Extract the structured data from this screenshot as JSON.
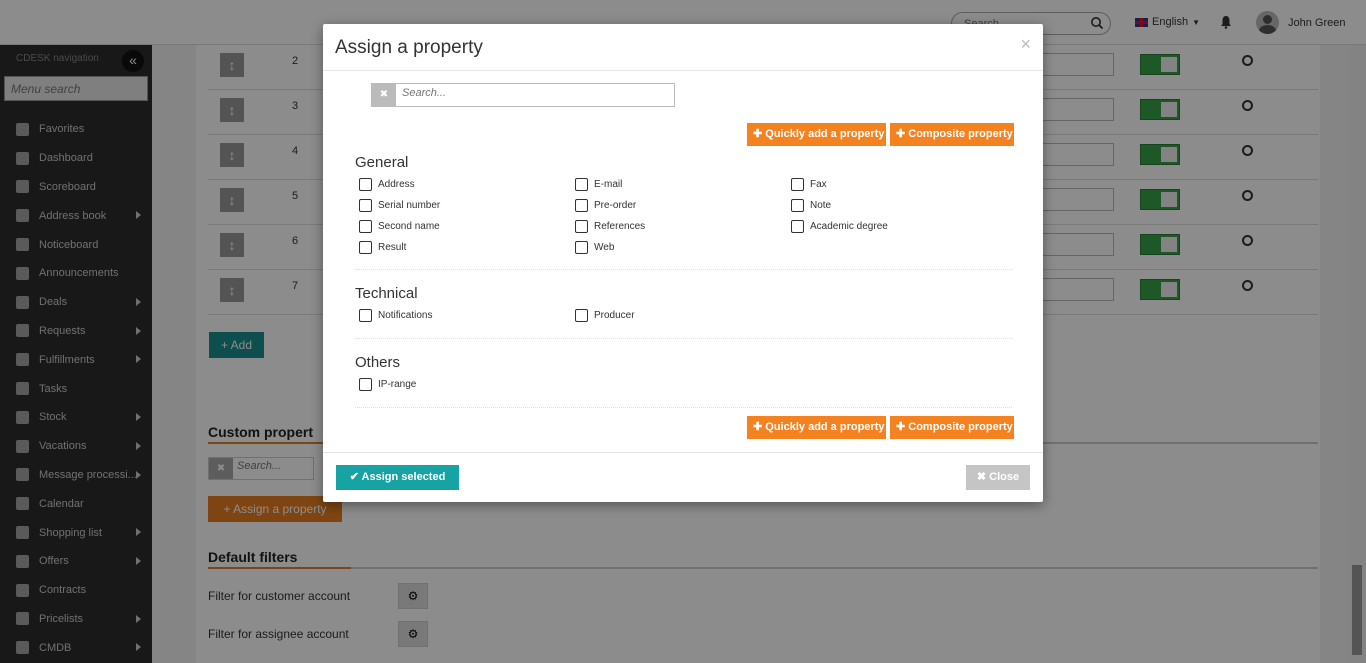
{
  "topbar": {
    "search_placeholder": "Search",
    "language": "English",
    "user_name": "John Green"
  },
  "sidebar": {
    "title": "CDESK navigation",
    "search_placeholder": "Menu search",
    "collapse_glyph": "«",
    "items": [
      {
        "label": "Favorites",
        "icon": "star-icon",
        "arrow": false
      },
      {
        "label": "Dashboard",
        "icon": "bar-chart-icon",
        "arrow": false
      },
      {
        "label": "Scoreboard",
        "icon": "line-chart-icon",
        "arrow": false
      },
      {
        "label": "Address book",
        "icon": "user-icon",
        "arrow": true
      },
      {
        "label": "Noticeboard",
        "icon": "paper-plane-icon",
        "arrow": false
      },
      {
        "label": "Announcements",
        "icon": "bullhorn-icon",
        "arrow": false
      },
      {
        "label": "Deals",
        "icon": "credit-card-icon",
        "arrow": true
      },
      {
        "label": "Requests",
        "icon": "check-circle-icon",
        "arrow": true
      },
      {
        "label": "Fulfillments",
        "icon": "cube-icon",
        "arrow": true
      },
      {
        "label": "Tasks",
        "icon": "list-icon",
        "arrow": false
      },
      {
        "label": "Stock",
        "icon": "archive-icon",
        "arrow": true
      },
      {
        "label": "Vacations",
        "icon": "plane-icon",
        "arrow": true
      },
      {
        "label": "Message processi...",
        "icon": "envelope-icon",
        "arrow": true
      },
      {
        "label": "Calendar",
        "icon": "calendar-icon",
        "arrow": false
      },
      {
        "label": "Shopping list",
        "icon": "cart-icon",
        "arrow": true
      },
      {
        "label": "Offers",
        "icon": "gift-icon",
        "arrow": true
      },
      {
        "label": "Contracts",
        "icon": "file-icon",
        "arrow": false
      },
      {
        "label": "Pricelists",
        "icon": "file-text-icon",
        "arrow": true
      },
      {
        "label": "CMDB",
        "icon": "folder-icon",
        "arrow": true
      }
    ]
  },
  "content": {
    "rows": [
      "2",
      "3",
      "4",
      "5",
      "6",
      "7"
    ],
    "add_label": "+ Add",
    "custom_properties_title": "Custom propert",
    "custom_search_placeholder": "Search...",
    "assign_property_label": "+ Assign a property",
    "default_filters_title": "Default filters",
    "filter_customer": "Filter for customer account",
    "filter_assignee": "Filter for assignee account"
  },
  "modal": {
    "title": "Assign a property",
    "close_x": "×",
    "search_placeholder": "Search...",
    "quick_add_label": "✚ Quickly add a property",
    "composite_label": "✚ Composite property",
    "groups": {
      "general": {
        "title": "General",
        "items": [
          "Address",
          "E-mail",
          "Fax",
          "Serial number",
          "Pre-order",
          "Note",
          "Second name",
          "References",
          "Academic degree",
          "Result",
          "Web"
        ]
      },
      "technical": {
        "title": "Technical",
        "items": [
          "Notifications",
          "Producer"
        ]
      },
      "others": {
        "title": "Others",
        "items": [
          "IP-range"
        ]
      }
    },
    "assign_selected_label": "✔ Assign selected",
    "close_label": "✖ Close"
  },
  "colors": {
    "accent_orange": "#f58220",
    "teal": "#17a2a4",
    "toggle_green": "#3aa04a",
    "sidebar_bg": "#2d2d2d"
  }
}
